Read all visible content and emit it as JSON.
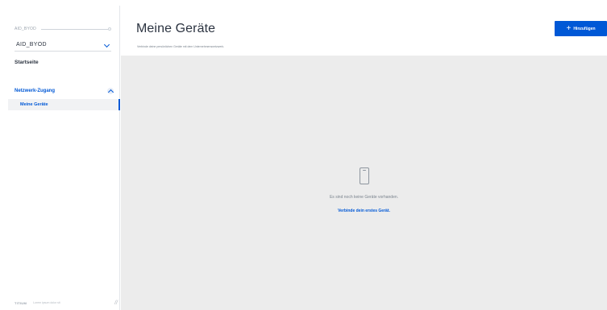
{
  "sidebar": {
    "org_label": "AID_BYOD",
    "org_select_value": "AID_BYOD",
    "nav_start": "Startseite",
    "nav_section": "Netzwerk-Zugang",
    "nav_active_item": "Meine Geräte",
    "footer_brand": "TITIUM",
    "footer_text": "Lorem ipsum dolor sit"
  },
  "header": {
    "title": "Meine Geräte",
    "subtitle": "Verbinde deine persönlichen Geräte mit dem Unternehmensnetzwerk.",
    "add_button_label": "Hinzufügen"
  },
  "empty_state": {
    "message": "Es sind noch keine Geräte vorhanden.",
    "link": "Verbinde dein erstes Gerät."
  },
  "icons": [
    "chevron-down-icon",
    "chevron-up-icon",
    "plus-icon",
    "smartphone-icon",
    "slash-icon"
  ],
  "colors": {
    "accent": "#0058d6",
    "content_bg": "#ececec",
    "text": "#2b3340",
    "muted": "#7a838d"
  }
}
